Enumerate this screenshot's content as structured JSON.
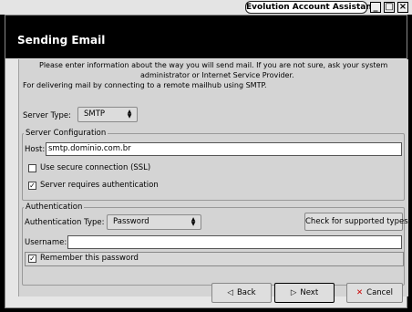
{
  "window": {
    "title": "Evolution Account Assistant"
  },
  "header": {
    "title": "Sending Email"
  },
  "intro": {
    "line1": "Please enter information about the way you will send mail. If you are not sure, ask your system",
    "line2": "administrator or Internet Service Provider.",
    "line3": "For delivering mail by connecting to a remote mailhub using SMTP."
  },
  "server_type": {
    "label": "Server Type:",
    "value": "SMTP"
  },
  "server_config": {
    "title": "Server Configuration",
    "host_label": "Host:",
    "host_value": "smtp.dominio.com.br",
    "ssl_label": "Use secure connection (SSL)",
    "ssl_checked": false,
    "auth_required_label": "Server requires authentication",
    "auth_required_checked": true
  },
  "authentication": {
    "title": "Authentication",
    "type_label": "Authentication Type:",
    "type_value": "Password",
    "check_button": "Check for supported types",
    "username_label": "Username:",
    "username_value": "",
    "remember_label": "Remember this password",
    "remember_checked": true
  },
  "buttons": {
    "back": "Back",
    "next": "Next",
    "cancel": "Cancel"
  },
  "icons": {
    "check_mark": "✓",
    "back_arrow": "◁",
    "next_arrow": "▷",
    "cancel_x": "✕"
  }
}
